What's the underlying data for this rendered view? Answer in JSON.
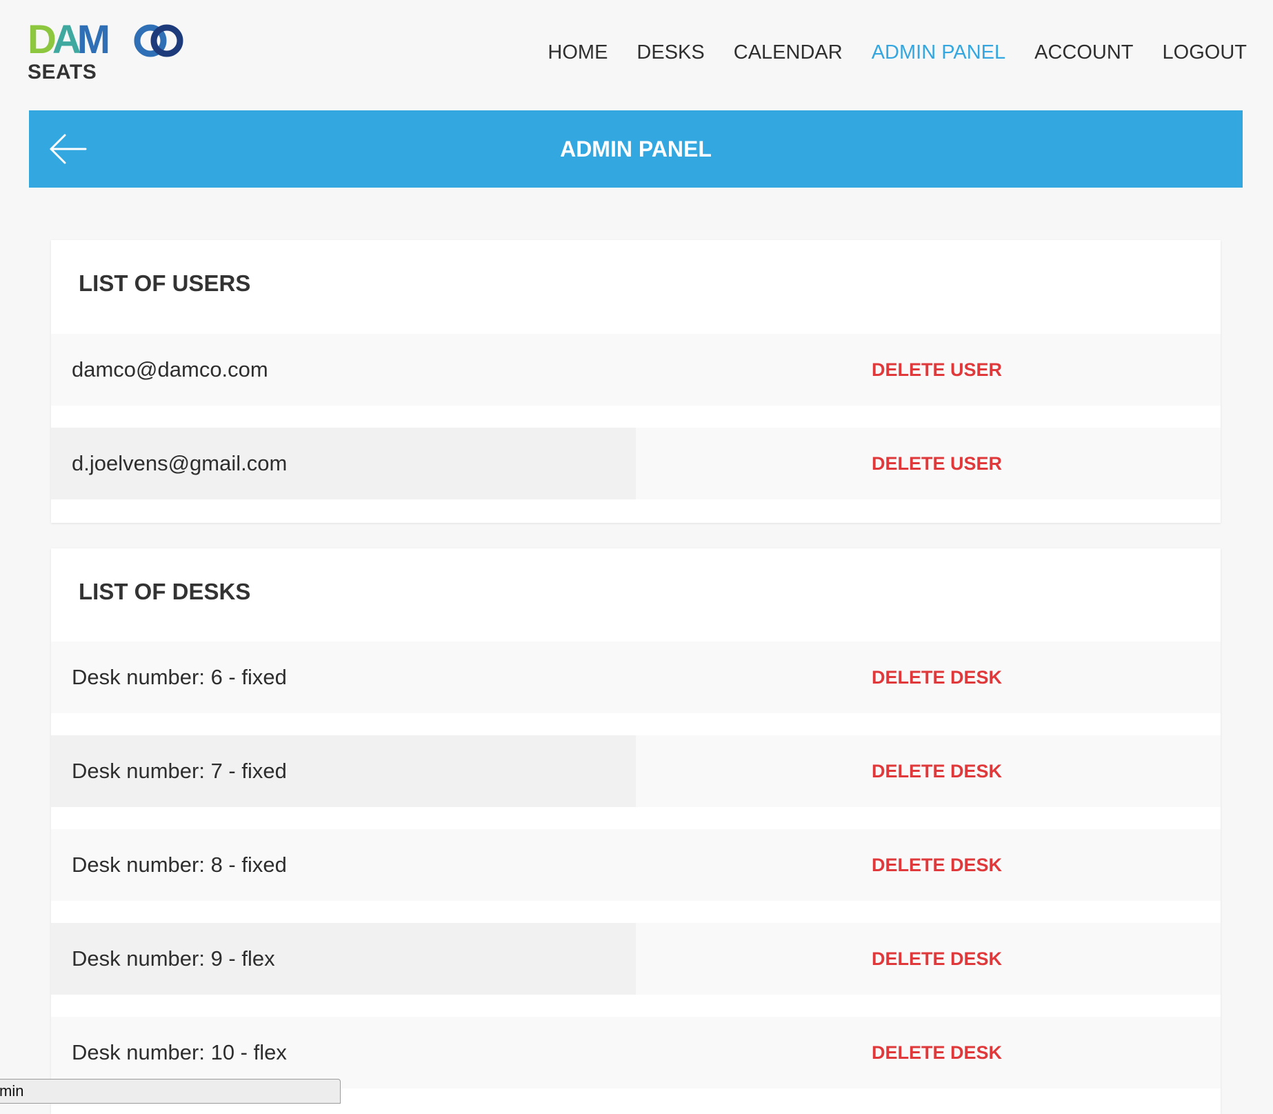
{
  "brand": {
    "logo_text_parts": [
      "D",
      "A",
      "M"
    ],
    "subtitle": "SEATS",
    "colors": {
      "green": "#8dc63f",
      "teal": "#3fa9a0",
      "blue": "#2e6fb5",
      "navy": "#1d3a7a"
    }
  },
  "nav": {
    "items": [
      {
        "label": "HOME",
        "active": false
      },
      {
        "label": "DESKS",
        "active": false
      },
      {
        "label": "CALENDAR",
        "active": false
      },
      {
        "label": "ADMIN PANEL",
        "active": true
      },
      {
        "label": "ACCOUNT",
        "active": false
      },
      {
        "label": "LOGOUT",
        "active": false
      }
    ],
    "active_color": "#34a7e0"
  },
  "title_bar": {
    "title": "ADMIN PANEL",
    "back_icon": "arrow-left-icon",
    "color": "#33a7e0"
  },
  "users": {
    "title": "LIST OF USERS",
    "items": [
      {
        "label": "damco@damco.com",
        "action": "DELETE USER"
      },
      {
        "label": "d.joelvens@gmail.com",
        "action": "DELETE USER"
      }
    ]
  },
  "desks": {
    "title": "LIST OF DESKS",
    "items": [
      {
        "label": "Desk number: 6 - fixed",
        "action": "DELETE DESK"
      },
      {
        "label": "Desk number: 7 - fixed",
        "action": "DELETE DESK"
      },
      {
        "label": "Desk number: 8 - fixed",
        "action": "DELETE DESK"
      },
      {
        "label": "Desk number: 9 - flex",
        "action": "DELETE DESK"
      },
      {
        "label": "Desk number: 10 - flex",
        "action": "DELETE DESK"
      }
    ]
  },
  "action_color": "#e0393b",
  "status_tip": {
    "text": "min"
  }
}
